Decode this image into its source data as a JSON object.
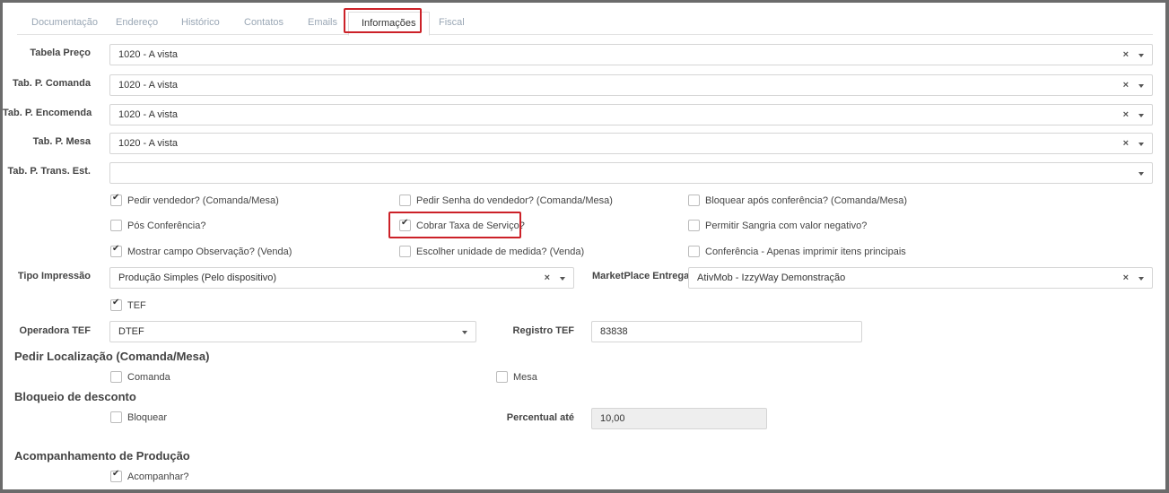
{
  "tabs": [
    "Documentação",
    "Endereço",
    "Histórico",
    "Contatos",
    "Emails",
    "Informações",
    "Fiscal"
  ],
  "price_tables": [
    {
      "label": "Tabela Preço",
      "value": "1020 - A vista",
      "clear": "×"
    },
    {
      "label": "Tab. P. Comanda",
      "value": "1020 - A vista",
      "clear": "×"
    },
    {
      "label": "Tab. P. Encomenda",
      "value": "1020 - A vista",
      "clear": "×"
    },
    {
      "label": "Tab. P. Mesa",
      "value": "1020 - A vista",
      "clear": "×"
    },
    {
      "label": "Tab. P. Trans. Est.",
      "value": ""
    }
  ],
  "options": [
    {
      "label": "Pedir vendedor? (Comanda/Mesa)",
      "checked": true
    },
    {
      "label": "Pedir Senha do vendedor? (Comanda/Mesa)",
      "checked": false
    },
    {
      "label": "Bloquear após conferência? (Comanda/Mesa)",
      "checked": false
    },
    {
      "label": "Pós Conferência?",
      "checked": false
    },
    {
      "label": "Cobrar Taxa de Serviço?",
      "checked": true
    },
    {
      "label": "Permitir Sangria com valor negativo?",
      "checked": false
    },
    {
      "label": "Mostrar campo Observação? (Venda)",
      "checked": true
    },
    {
      "label": "Escolher unidade de medida? (Venda)",
      "checked": false
    },
    {
      "label": "Conferência - Apenas imprimir itens principais",
      "checked": false
    }
  ],
  "tipo_impressao": {
    "label": "Tipo Impressão",
    "value": "Produção Simples (Pelo dispositivo)",
    "clear": "×"
  },
  "marketplace": {
    "label": "MarketPlace Entrega",
    "value": "AtivMob - IzzyWay Demonstração",
    "clear": "×"
  },
  "tef": {
    "label": "TEF",
    "checked": true
  },
  "operadora_tef": {
    "label": "Operadora TEF",
    "value": "DTEF"
  },
  "registro_tef": {
    "label": "Registro TEF",
    "value": "83838"
  },
  "pedir_localizacao": {
    "title": "Pedir Localização (Comanda/Mesa)",
    "comanda": {
      "label": "Comanda",
      "checked": false
    },
    "mesa": {
      "label": "Mesa",
      "checked": false
    }
  },
  "bloqueio_desconto": {
    "title": "Bloqueio de desconto",
    "bloquear": {
      "label": "Bloquear",
      "checked": false
    },
    "percentual_label": "Percentual até",
    "percentual_value": "10,00"
  },
  "acompanhamento": {
    "title": "Acompanhamento de Produção",
    "acompanhar": {
      "label": "Acompanhar?",
      "checked": true
    }
  },
  "colors": {
    "highlight": "#cc2128",
    "tab_inactive": "#9aa7b5",
    "frame": "#6b6b6b"
  }
}
